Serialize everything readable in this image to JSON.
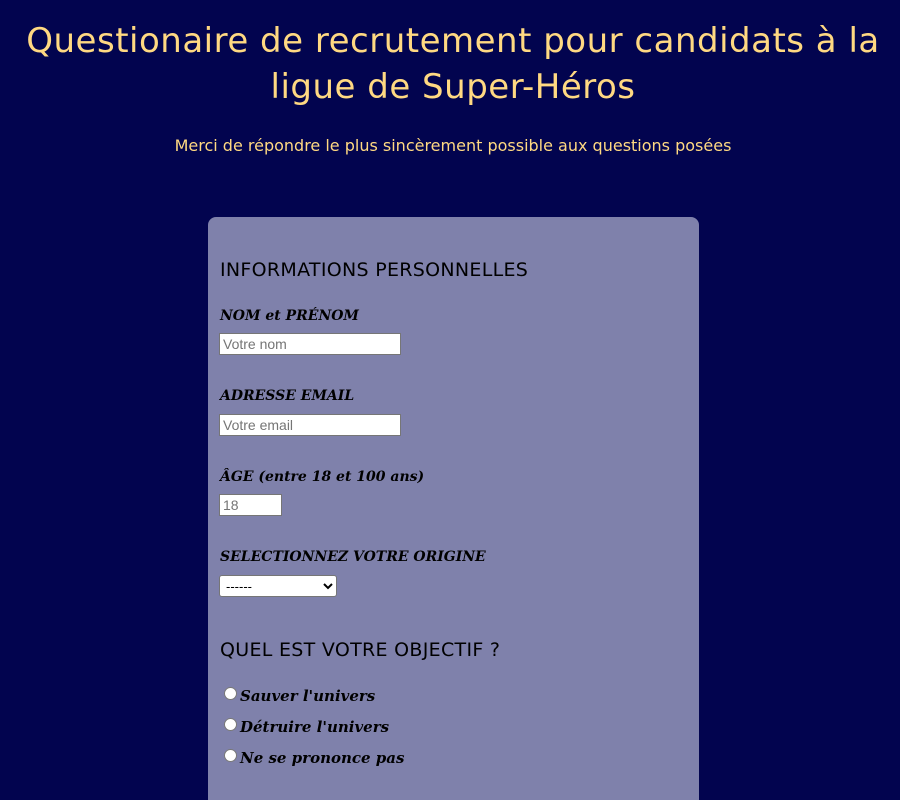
{
  "header": {
    "title": "Questionaire de recrutement pour candidats à la ligue de Super-Héros",
    "subtitle": "Merci de répondre le plus sincèrement possible aux questions posées"
  },
  "form": {
    "personal_section": {
      "title": "INFORMATIONS PERSONNELLES",
      "name": {
        "label": "NOM et PRÉNOM",
        "placeholder": "Votre nom",
        "value": ""
      },
      "email": {
        "label": "ADRESSE EMAIL",
        "placeholder": "Votre email",
        "value": ""
      },
      "age": {
        "label": "ÂGE (entre 18 et 100 ans)",
        "placeholder": "18",
        "value": ""
      },
      "origin": {
        "label": "SELECTIONNEZ VOTRE ORIGINE",
        "selected": "------"
      }
    },
    "objective_section": {
      "title": "QUEL EST VOTRE OBJECTIF ?",
      "options": [
        "Sauver l'univers",
        "Détruire l'univers",
        "Ne se prononce pas"
      ]
    }
  },
  "colors": {
    "background": "#02044f",
    "heading_text": "#ffd982",
    "card_background": "#7f81ab"
  }
}
